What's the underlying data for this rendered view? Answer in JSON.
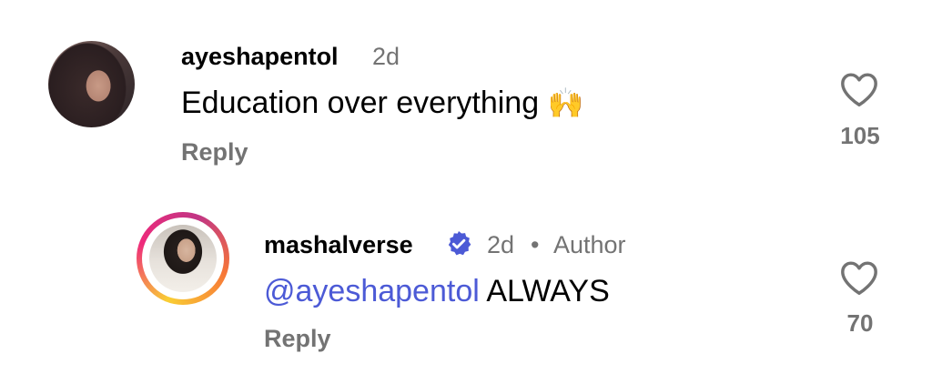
{
  "comments": [
    {
      "username": "ayeshapentol",
      "time": "2d",
      "text": "Education over everything",
      "emoji": "🙌",
      "reply_label": "Reply",
      "likes": "105",
      "like_icon": "heart-outline-icon"
    },
    {
      "username": "mashalverse",
      "verified_icon": "verified-badge-icon",
      "time": "2d",
      "separator": "•",
      "role": "Author",
      "mention": "@ayeshapentol",
      "text": "ALWAYS",
      "reply_label": "Reply",
      "likes": "70",
      "like_icon": "heart-outline-icon"
    }
  ],
  "colors": {
    "mention": "#4c5ad6",
    "verified": "#4c5ad6",
    "muted": "#737373"
  }
}
